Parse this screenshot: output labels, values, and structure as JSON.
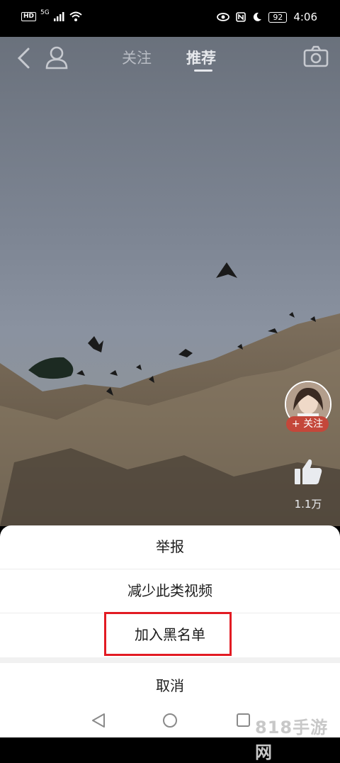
{
  "status_bar": {
    "network_badge": "HD",
    "network_type": "5G",
    "battery": "92",
    "time": "4:06"
  },
  "top_nav": {
    "tabs": [
      {
        "label": "关注"
      },
      {
        "label": "推荐"
      }
    ],
    "active_tab": "推荐"
  },
  "side_actions": {
    "follow_label": "+ 关注",
    "like_count": "1.1万"
  },
  "sheet": {
    "items": [
      {
        "label": "举报"
      },
      {
        "label": "减少此类视频"
      },
      {
        "label": "加入黑名单"
      }
    ],
    "cancel_label": "取消",
    "highlight_color": "#e21b23"
  },
  "watermark": "818手游网",
  "icons": [
    "back-icon",
    "user-icon",
    "camera-icon",
    "like-icon",
    "nav-back-icon",
    "nav-home-icon",
    "nav-recent-icon",
    "wifi-icon",
    "signal-icon",
    "eye-icon",
    "nfc-icon",
    "moon-icon"
  ]
}
